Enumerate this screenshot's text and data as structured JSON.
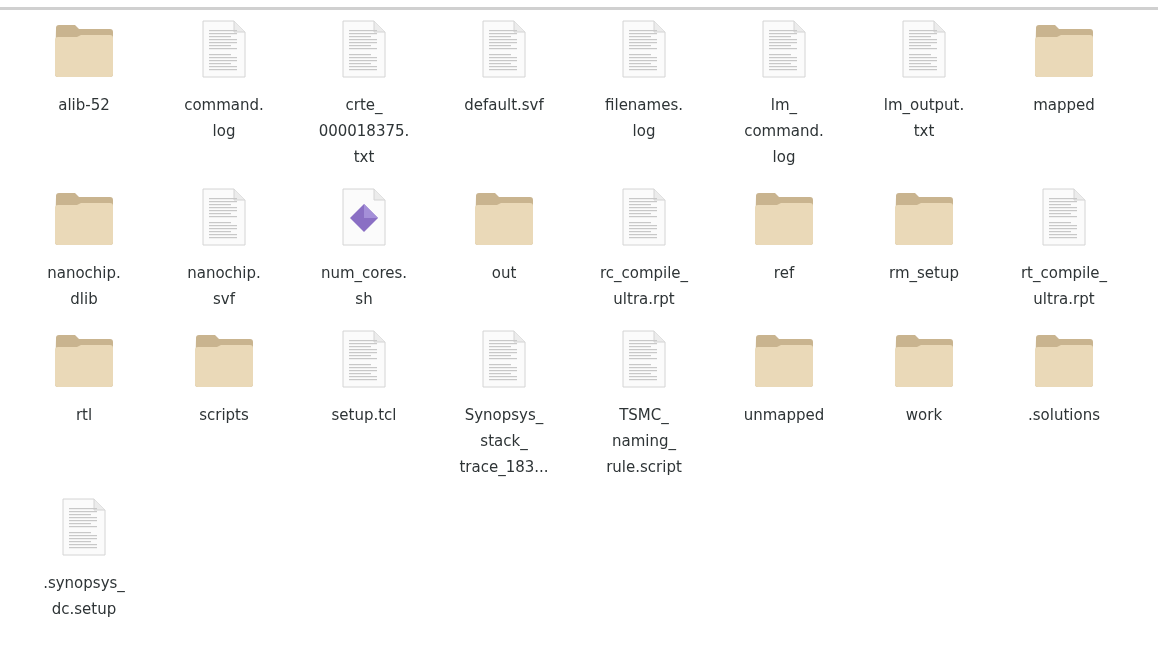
{
  "files": [
    {
      "kind": "folder",
      "name_lines": [
        "alib-52"
      ]
    },
    {
      "kind": "text",
      "name_lines": [
        "command.",
        "log"
      ]
    },
    {
      "kind": "text",
      "name_lines": [
        "crte_",
        "000018375.",
        "txt"
      ]
    },
    {
      "kind": "text",
      "name_lines": [
        "default.svf"
      ]
    },
    {
      "kind": "text",
      "name_lines": [
        "filenames.",
        "log"
      ]
    },
    {
      "kind": "text",
      "name_lines": [
        "lm_",
        "command.",
        "log"
      ]
    },
    {
      "kind": "text",
      "name_lines": [
        "lm_output.",
        "txt"
      ]
    },
    {
      "kind": "folder",
      "name_lines": [
        "mapped"
      ]
    },
    {
      "kind": "folder",
      "name_lines": [
        "nanochip.",
        "dlib"
      ]
    },
    {
      "kind": "text",
      "name_lines": [
        "nanochip.",
        "svf"
      ]
    },
    {
      "kind": "script",
      "name_lines": [
        "num_cores.",
        "sh"
      ]
    },
    {
      "kind": "folder",
      "name_lines": [
        "out"
      ]
    },
    {
      "kind": "text",
      "name_lines": [
        "rc_compile_",
        "ultra.rpt"
      ]
    },
    {
      "kind": "folder",
      "name_lines": [
        "ref"
      ]
    },
    {
      "kind": "folder",
      "name_lines": [
        "rm_setup"
      ]
    },
    {
      "kind": "text",
      "name_lines": [
        "rt_compile_",
        "ultra.rpt"
      ]
    },
    {
      "kind": "folder",
      "name_lines": [
        "rtl"
      ]
    },
    {
      "kind": "folder",
      "name_lines": [
        "scripts"
      ]
    },
    {
      "kind": "text",
      "name_lines": [
        "setup.tcl"
      ]
    },
    {
      "kind": "text",
      "name_lines": [
        "Synopsys_",
        "stack_",
        "trace_183..."
      ]
    },
    {
      "kind": "text",
      "name_lines": [
        "TSMC_",
        "naming_",
        "rule.script"
      ]
    },
    {
      "kind": "folder",
      "name_lines": [
        "unmapped"
      ]
    },
    {
      "kind": "folder",
      "name_lines": [
        "work"
      ]
    },
    {
      "kind": "folder",
      "name_lines": [
        ".solutions"
      ]
    },
    {
      "kind": "text",
      "name_lines": [
        ".synopsys_",
        "dc.setup"
      ]
    }
  ]
}
